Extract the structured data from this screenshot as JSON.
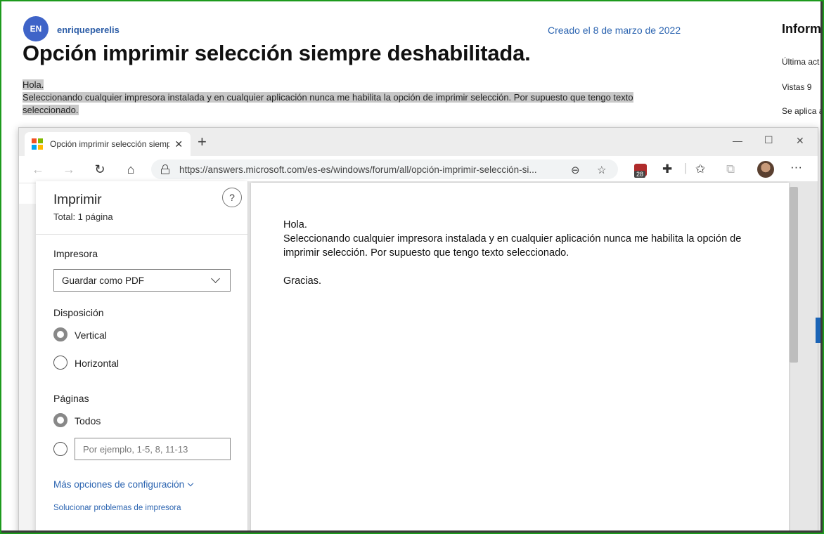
{
  "forum": {
    "avatar_initials": "EN",
    "username": "enriqueperelis",
    "created": "Creado el 8 de marzo de 2022",
    "title": "Opción imprimir selección siempre deshabilitada.",
    "body_line1": "Hola.",
    "body_line2": "Seleccionando cualquier impresora instalada y en cualquier aplicación nunca me habilita la opción de imprimir selección. Por supuesto que tengo texto",
    "body_line3": "seleccionado.",
    "side_title": "Informa",
    "side_last": "Última act",
    "side_views": "Vistas 9",
    "side_applies": "Se aplica a"
  },
  "browser": {
    "tab_title": "Opción imprimir selección siemp",
    "url": "https://answers.microsoft.com/es-es/windows/forum/all/opción-imprimir-selección-si...",
    "extension_count": "28"
  },
  "print": {
    "title": "Imprimir",
    "total": "Total: 1 página",
    "help": "?",
    "printer_label": "Impresora",
    "printer_value": "Guardar como PDF",
    "layout_label": "Disposición",
    "layout_vertical": "Vertical",
    "layout_horizontal": "Horizontal",
    "pages_label": "Páginas",
    "pages_all": "Todos",
    "pages_placeholder": "Por ejemplo, 1-5, 8, 11-13",
    "more_settings": "Más opciones de configuración",
    "troubleshoot": "Solucionar problemas de impresora"
  },
  "preview": {
    "line1": "Hola.",
    "line2": "Seleccionando cualquier impresora instalada y en cualquier aplicación nunca me habilita la opción de imprimir selección. Por supuesto que tengo texto seleccionado.",
    "line3": "Gracias."
  },
  "colors": {
    "accent": "#2a63b0",
    "avatar": "#3f64c8",
    "frame": "#1d9a1d"
  }
}
